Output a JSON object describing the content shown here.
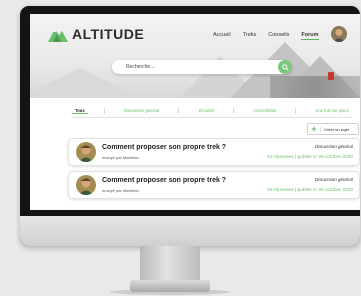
{
  "brand": {
    "name": "ALTITUDE",
    "accent": "#6abf69"
  },
  "nav": {
    "items": [
      "Accueil",
      "Treks",
      "Conseils",
      "Forum"
    ],
    "active": "Forum"
  },
  "search": {
    "placeholder": "Recherche..."
  },
  "tabs": {
    "items": [
      "Tous",
      "Discussion général",
      "Sécurité",
      "Accessibilité",
      "Une fois sur place"
    ],
    "active": "Tous"
  },
  "create_button": {
    "label": "Créer un sujet"
  },
  "topics": [
    {
      "title": "Comment proposer son propre trek ?",
      "author": "envoyé par Mathieux",
      "category": "Discussion général",
      "stats": "53 réponses | publier le 29 octobre 2020"
    },
    {
      "title": "Comment proposer son propre trek ?",
      "author": "envoyé par Mathieux",
      "category": "Discussion général",
      "stats": "53 réponses | publier le 29 octobre 2020"
    }
  ]
}
